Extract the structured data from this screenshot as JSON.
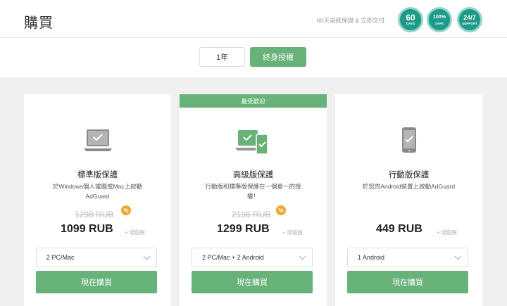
{
  "header": {
    "title": "購買",
    "guarantee": "60天退款保證 & 立即交付",
    "badges": [
      {
        "name": "money-back-badge",
        "big": "60",
        "small": "DAYS"
      },
      {
        "name": "safe-badge",
        "big": "100%",
        "small": "SAFE"
      },
      {
        "name": "support-badge",
        "big": "24/7",
        "small": "SUPPORT"
      }
    ]
  },
  "toggle": {
    "year": "1年",
    "lifetime": "終身授權"
  },
  "ribbon": "最受歡迎",
  "plans": [
    {
      "name": "標準版保護",
      "desc": "於Windows個人電腦或Mac上啟動AdGuard",
      "old_price": "1298 RUB",
      "pct": "%",
      "price": "1099 RUB",
      "vat": "+ 增值稅",
      "select": "2 PC/Mac",
      "buy": "現在購買"
    },
    {
      "name": "高級版保護",
      "desc": "行動版和標準版保護在一個單一的授權！",
      "old_price": "2196 RUB",
      "pct": "%",
      "price": "1299 RUB",
      "vat": "+ 增值稅",
      "select": "2 PC/Mac + 2 Android",
      "buy": "現在購買"
    },
    {
      "name": "行動版保護",
      "desc": "於您的Android裝置上啟動AdGuard",
      "price": "449 RUB",
      "vat": "+ 增值稅",
      "select": "1 Android",
      "buy": "現在購買"
    }
  ],
  "colors": {
    "accent": "#67b279",
    "badge": "#1e9a8a",
    "discount": "#f2a531"
  }
}
